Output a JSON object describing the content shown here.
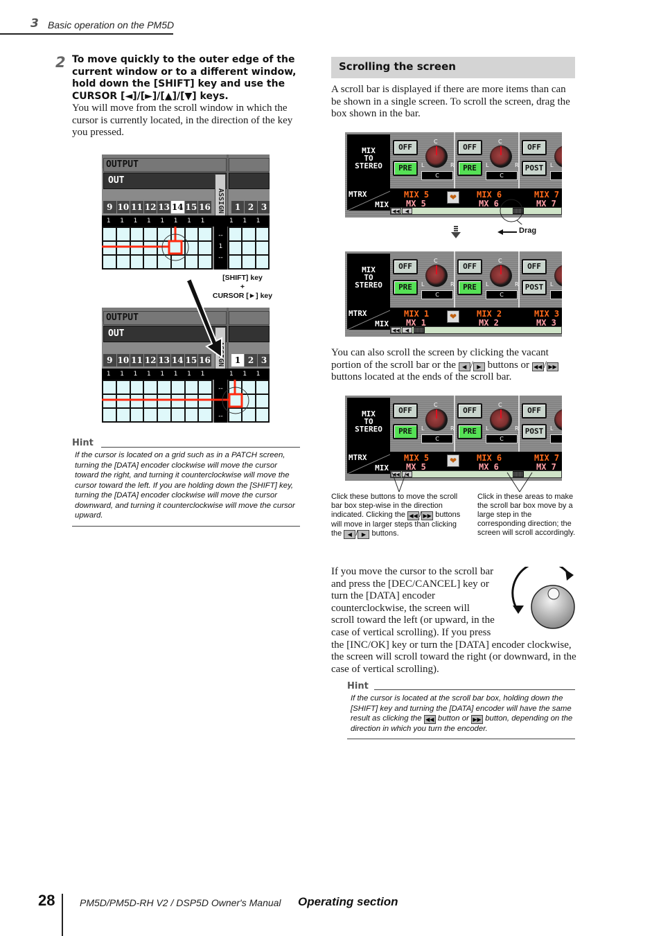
{
  "header": {
    "chapter_number": "3",
    "chapter_title": "Basic operation on the PM5D"
  },
  "step2": {
    "number": "2",
    "heading": "To move quickly to the outer edge of the current window or to a different window, hold down the [SHIFT] key and use the CURSOR [◄]/[►]/[▲]/[▼] keys.",
    "body": "You will move from the scroll window in which the cursor is currently located, in the direction of the key you pressed."
  },
  "patch_screens": {
    "output_label": "OUTPUT",
    "out_label": "OUT",
    "assign_label": "ASSIGN",
    "left_channels": [
      "9",
      "10",
      "11",
      "12",
      "13",
      "14",
      "15",
      "16"
    ],
    "right_channels": [
      "1",
      "2",
      "3"
    ],
    "row_value": "1",
    "assign_value": "1",
    "assign_dash": "--",
    "before_selected": "14",
    "after_selected": "1",
    "transition_caption_line1": "[SHIFT] key",
    "transition_caption_line2": "+",
    "transition_caption_line3": "CURSOR [►] key"
  },
  "hint1": {
    "label": "Hint",
    "text": "If the cursor is located on a grid such as in a PATCH screen, turning the [DATA] encoder clockwise will move the cursor toward the right, and turning it counterclockwise will move the cursor toward the left. If you are holding down the [SHIFT] key, turning the [DATA] encoder clockwise will move the cursor downward, and turning it counterclockwise will move the cursor upward."
  },
  "section": {
    "heading": "Scrolling the screen",
    "intro": "A scroll bar is displayed if there are more items than can be shown in a single screen. To scroll the screen, drag the box shown in the bar."
  },
  "mixer_screens": {
    "left_title_lines": [
      "MIX",
      "TO",
      "STEREO"
    ],
    "corner_top": "MTRX",
    "corner_bottom": "MIX",
    "off_label": "OFF",
    "pre_label": "PRE",
    "post_label": "POST",
    "knob_top": "C",
    "knob_left": "L",
    "knob_right": "R",
    "pan_value": "C",
    "screen1": {
      "names_top": [
        "MIX 5",
        "MIX 6",
        "MIX 7"
      ],
      "names_bottom": [
        "MX 5",
        "MX 6",
        "MX 7"
      ]
    },
    "screen2": {
      "names_top": [
        "MIX 1",
        "MIX 2",
        "MIX 3"
      ],
      "names_bottom": [
        "MX 1",
        "MX 2",
        "MX 3"
      ]
    },
    "screen3": {
      "names_top": [
        "MIX 5",
        "MIX 6",
        "MIX 7"
      ],
      "names_bottom": [
        "MX 5",
        "MX 6",
        "MX 7"
      ]
    },
    "drag_label": "Drag",
    "rewind_glyph": "◀◀",
    "back_glyph": "◀"
  },
  "paragraph2": {
    "part1": "You can also scroll the screen by clicking the vacant portion of the scroll bar or the",
    "part2": "buttons or",
    "part3": "buttons located at the ends of the scroll bar.",
    "btn_left": "◀",
    "btn_right": "▶",
    "btn_rew": "◀◀",
    "btn_ff": "▶▶"
  },
  "callouts": {
    "left_part1": "Click these buttons to move the scroll bar box step-wise in the direction indicated. Clicking the",
    "left_part2": "buttons will move in larger steps than clicking the",
    "left_part3": "buttons.",
    "right": "Click in these areas to make the scroll bar box move by a large step in the corresponding direction; the screen will scroll accordingly."
  },
  "paragraph3": {
    "text": "If you move the cursor to the scroll bar and press the [DEC/CANCEL] key or turn the [DATA] encoder counterclockwise, the screen will scroll toward the left (or upward, in the case of vertical scrolling). If you press the [INC/OK] key or turn the [DATA] encoder clockwise, the screen will scroll toward the right (or downward, in the case of vertical scrolling)."
  },
  "hint2": {
    "label": "Hint",
    "part1": "If the cursor is located at the scroll bar box, holding down the [SHIFT] key and turning the [DATA] encoder will have the same result as clicking the",
    "part2": "button or",
    "part3": "button, depending on the direction in which you turn the encoder."
  },
  "footer": {
    "page_number": "28",
    "manual_title": "PM5D/PM5D-RH V2 / DSP5D Owner's Manual",
    "section_name": "Operating section"
  }
}
